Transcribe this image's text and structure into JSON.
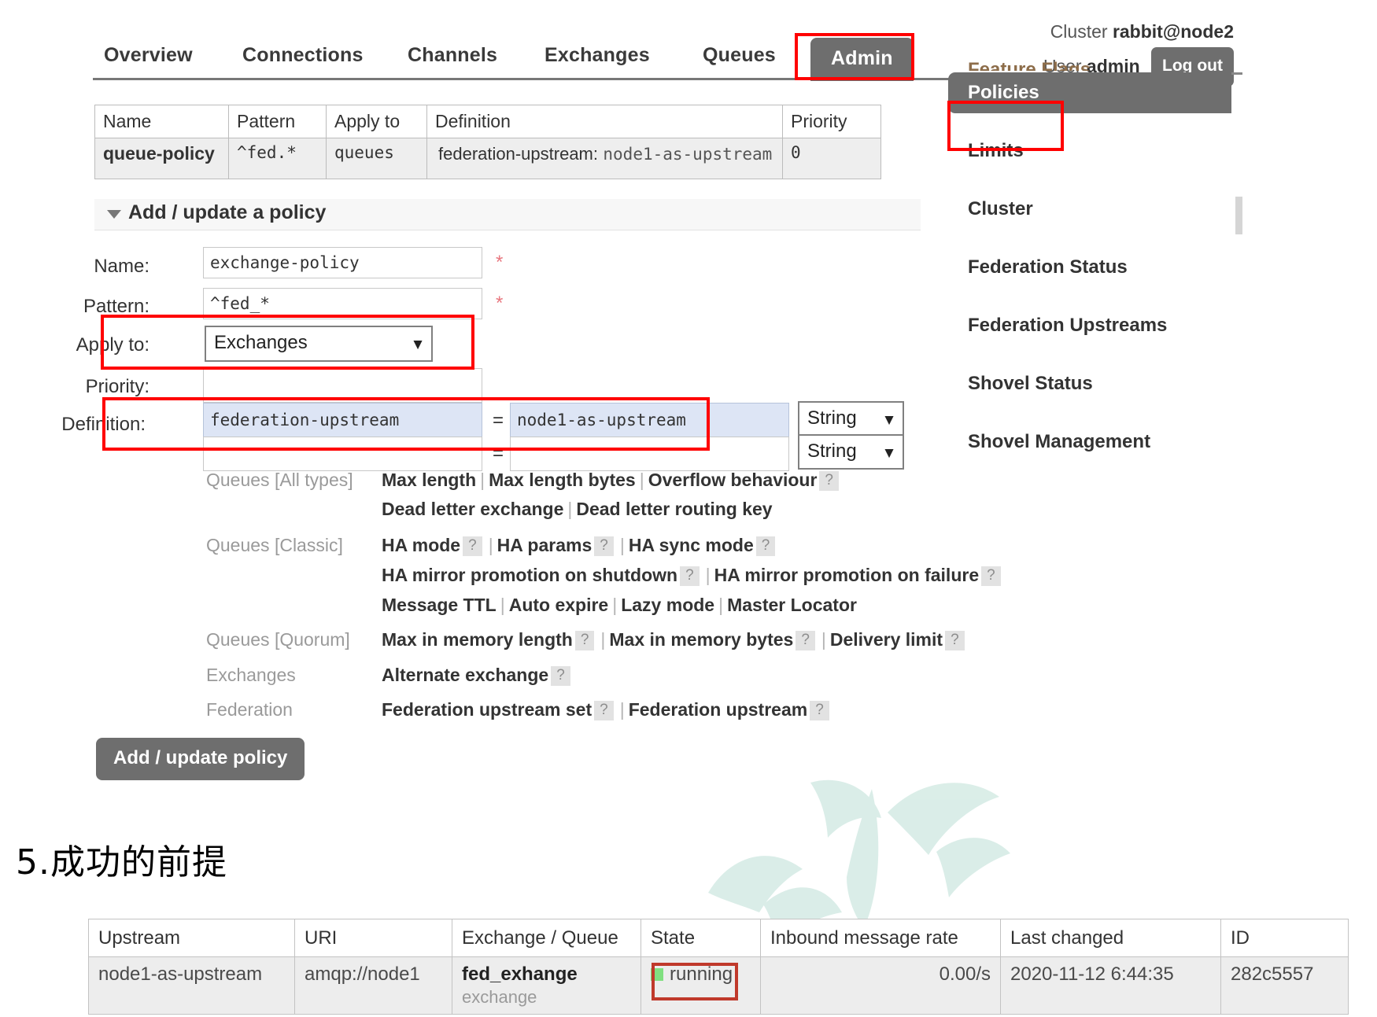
{
  "header": {
    "nav": [
      {
        "label": "Overview",
        "active": false
      },
      {
        "label": "Connections",
        "active": false
      },
      {
        "label": "Channels",
        "active": false
      },
      {
        "label": "Exchanges",
        "active": false
      },
      {
        "label": "Queues",
        "active": false
      },
      {
        "label": "Admin",
        "active": true
      }
    ],
    "cluster_label": "Cluster",
    "cluster_name": "rabbit@node2",
    "user_label": "User",
    "user_name": "admin",
    "logout_label": "Log out"
  },
  "sidebar": {
    "clipped_item": "Feature Flags",
    "items": [
      {
        "label": "Policies",
        "active": true
      },
      {
        "label": "Limits",
        "active": false
      },
      {
        "label": "Cluster",
        "active": false
      },
      {
        "label": "Federation Status",
        "active": false
      },
      {
        "label": "Federation Upstreams",
        "active": false
      },
      {
        "label": "Shovel Status",
        "active": false
      },
      {
        "label": "Shovel Management",
        "active": false
      }
    ]
  },
  "policies_table": {
    "columns": [
      "Name",
      "Pattern",
      "Apply to",
      "Definition",
      "Priority"
    ],
    "rows": [
      {
        "name": "queue-policy",
        "pattern": "^fed.*",
        "apply_to": "queues",
        "definition_key": "federation-upstream:",
        "definition_value": "node1-as-upstream",
        "priority": "0"
      }
    ]
  },
  "form": {
    "section_title": "Add / update a policy",
    "name_label": "Name:",
    "name_value": "exchange-policy",
    "name_required": "*",
    "pattern_label": "Pattern:",
    "pattern_value": "^fed_*",
    "pattern_required": "*",
    "apply_to_label": "Apply to:",
    "apply_to_value": "Exchanges",
    "priority_label": "Priority:",
    "priority_value": "",
    "definition_label": "Definition:",
    "definition_rows": [
      {
        "key": "federation-upstream",
        "eq": "=",
        "value": "node1-as-upstream",
        "type": "String"
      },
      {
        "key": "",
        "eq": "=",
        "value": "",
        "type": "String"
      }
    ],
    "submit_label": "Add / update policy"
  },
  "definition_hints": [
    {
      "category": "Queues [All types]",
      "lines": [
        [
          {
            "t": "Max length"
          },
          {
            "sep": "|"
          },
          {
            "t": "Max length bytes"
          },
          {
            "sep": "|"
          },
          {
            "t": "Overflow behaviour"
          },
          {
            "q": "?"
          }
        ],
        [
          {
            "t": "Dead letter exchange"
          },
          {
            "sep": "|"
          },
          {
            "t": "Dead letter routing key"
          }
        ]
      ]
    },
    {
      "category": "Queues [Classic]",
      "lines": [
        [
          {
            "t": "HA mode"
          },
          {
            "q": "?"
          },
          {
            "sep": "|"
          },
          {
            "t": "HA params"
          },
          {
            "q": "?"
          },
          {
            "sep": "|"
          },
          {
            "t": "HA sync mode"
          },
          {
            "q": "?"
          }
        ],
        [
          {
            "t": "HA mirror promotion on shutdown"
          },
          {
            "q": "?"
          },
          {
            "sep": "|"
          },
          {
            "t": "HA mirror promotion on failure"
          },
          {
            "q": "?"
          }
        ],
        [
          {
            "t": "Message TTL"
          },
          {
            "sep": "|"
          },
          {
            "t": "Auto expire"
          },
          {
            "sep": "|"
          },
          {
            "t": "Lazy mode"
          },
          {
            "sep": "|"
          },
          {
            "t": "Master Locator"
          }
        ]
      ]
    },
    {
      "category": "Queues [Quorum]",
      "lines": [
        [
          {
            "t": "Max in memory length"
          },
          {
            "q": "?"
          },
          {
            "sep": "|"
          },
          {
            "t": "Max in memory bytes"
          },
          {
            "q": "?"
          },
          {
            "sep": "|"
          },
          {
            "t": "Delivery limit"
          },
          {
            "q": "?"
          }
        ]
      ]
    },
    {
      "category": "Exchanges",
      "lines": [
        [
          {
            "t": "Alternate exchange"
          },
          {
            "q": "?"
          }
        ]
      ]
    },
    {
      "category": "Federation",
      "lines": [
        [
          {
            "t": "Federation upstream set"
          },
          {
            "q": "?"
          },
          {
            "sep": "|"
          },
          {
            "t": "Federation upstream"
          },
          {
            "q": "?"
          }
        ]
      ]
    }
  ],
  "cn_heading": "5.成功的前提",
  "federation_table": {
    "columns": [
      "Upstream",
      "URI",
      "Exchange / Queue",
      "State",
      "Inbound message rate",
      "Last changed",
      "ID"
    ],
    "rows": [
      {
        "upstream": "node1-as-upstream",
        "uri": "amqp://node1",
        "exchange_name": "fed_exhange",
        "exchange_kind": "exchange",
        "state": "running",
        "inbound_rate": "0.00/s",
        "last_changed": "2020-11-12 6:44:35",
        "id": "282c5557"
      }
    ]
  },
  "colors": {
    "accent_gray": "#6e6e6e",
    "annotation_red": "#ff0000",
    "annotation_dark_red": "#c0392b",
    "state_running": "#80e080",
    "selected_field": "#dde5f5"
  }
}
